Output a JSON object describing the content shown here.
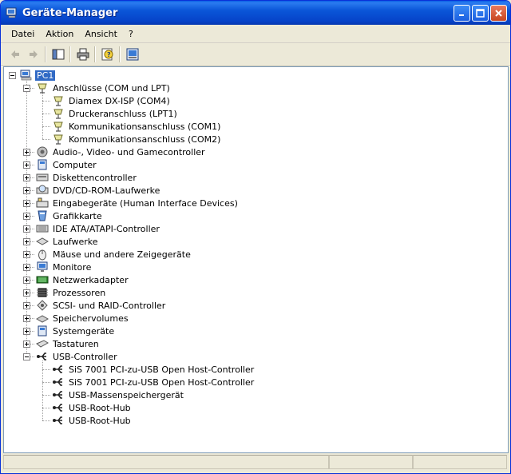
{
  "window": {
    "title": "Geräte-Manager"
  },
  "menu": [
    "Datei",
    "Aktion",
    "Ansicht",
    "?"
  ],
  "toolbar": [
    "back-icon",
    "forward-icon",
    "show-hide-console-tree-icon",
    "print-icon",
    "help-icon",
    "properties-icon"
  ],
  "tree": [
    {
      "label": "PC1",
      "level": 0,
      "expand": "minus",
      "icon": "computer-icon",
      "selected": true
    },
    {
      "label": "Anschlüsse (COM und LPT)",
      "level": 1,
      "expand": "minus",
      "icon": "port-icon"
    },
    {
      "label": "Diamex DX-ISP (COM4)",
      "level": 2,
      "icon": "port-icon"
    },
    {
      "label": "Druckeranschluss (LPT1)",
      "level": 2,
      "icon": "port-icon"
    },
    {
      "label": "Kommunikationsanschluss (COM1)",
      "level": 2,
      "icon": "port-icon"
    },
    {
      "label": "Kommunikationsanschluss (COM2)",
      "level": 2,
      "icon": "port-icon"
    },
    {
      "label": "Audio-, Video- und Gamecontroller",
      "level": 1,
      "expand": "plus",
      "icon": "audio-icon"
    },
    {
      "label": "Computer",
      "level": 1,
      "expand": "plus",
      "icon": "computer-device-icon"
    },
    {
      "label": "Diskettencontroller",
      "level": 1,
      "expand": "plus",
      "icon": "floppy-controller-icon"
    },
    {
      "label": "DVD/CD-ROM-Laufwerke",
      "level": 1,
      "expand": "plus",
      "icon": "cdrom-icon"
    },
    {
      "label": "Eingabegeräte (Human Interface Devices)",
      "level": 1,
      "expand": "plus",
      "icon": "hid-icon"
    },
    {
      "label": "Grafikkarte",
      "level": 1,
      "expand": "plus",
      "icon": "display-adapter-icon"
    },
    {
      "label": "IDE ATA/ATAPI-Controller",
      "level": 1,
      "expand": "plus",
      "icon": "ide-icon"
    },
    {
      "label": "Laufwerke",
      "level": 1,
      "expand": "plus",
      "icon": "disk-drive-icon"
    },
    {
      "label": "Mäuse und andere Zeigegeräte",
      "level": 1,
      "expand": "plus",
      "icon": "mouse-icon"
    },
    {
      "label": "Monitore",
      "level": 1,
      "expand": "plus",
      "icon": "monitor-icon"
    },
    {
      "label": "Netzwerkadapter",
      "level": 1,
      "expand": "plus",
      "icon": "network-icon"
    },
    {
      "label": "Prozessoren",
      "level": 1,
      "expand": "plus",
      "icon": "processor-icon"
    },
    {
      "label": "SCSI- und RAID-Controller",
      "level": 1,
      "expand": "plus",
      "icon": "scsi-icon"
    },
    {
      "label": "Speichervolumes",
      "level": 1,
      "expand": "plus",
      "icon": "volume-icon"
    },
    {
      "label": "Systemgeräte",
      "level": 1,
      "expand": "plus",
      "icon": "system-device-icon"
    },
    {
      "label": "Tastaturen",
      "level": 1,
      "expand": "plus",
      "icon": "keyboard-icon"
    },
    {
      "label": "USB-Controller",
      "level": 1,
      "expand": "minus",
      "icon": "usb-icon"
    },
    {
      "label": "SiS 7001 PCI-zu-USB Open Host-Controller",
      "level": 2,
      "icon": "usb-icon"
    },
    {
      "label": "SiS 7001 PCI-zu-USB Open Host-Controller",
      "level": 2,
      "icon": "usb-icon"
    },
    {
      "label": "USB-Massenspeichergerät",
      "level": 2,
      "icon": "usb-icon"
    },
    {
      "label": "USB-Root-Hub",
      "level": 2,
      "icon": "usb-icon"
    },
    {
      "label": "USB-Root-Hub",
      "level": 2,
      "icon": "usb-icon"
    }
  ]
}
